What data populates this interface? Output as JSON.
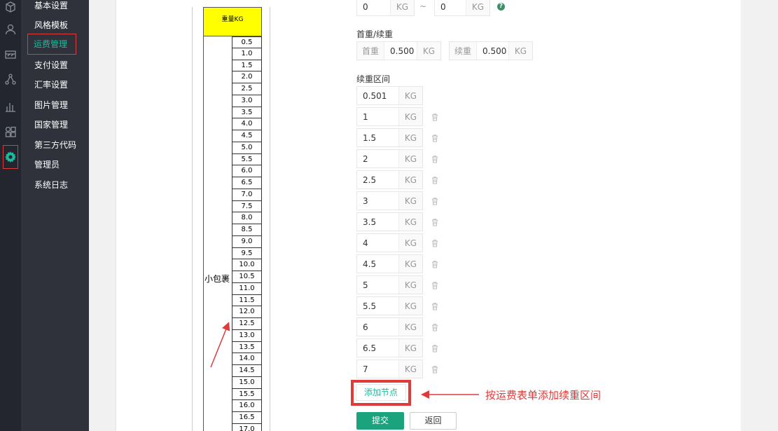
{
  "sidebar": {
    "icons": [
      "cube-icon",
      "user-icon",
      "card-icon",
      "network-icon",
      "bar-chart-icon",
      "grid-icon",
      "gear-icon"
    ],
    "items": [
      {
        "label": "基本设置"
      },
      {
        "label": "风格模板"
      },
      {
        "label": "运费管理",
        "active": true
      },
      {
        "label": "支付设置"
      },
      {
        "label": "汇率设置"
      },
      {
        "label": "图片管理"
      },
      {
        "label": "国家管理"
      },
      {
        "label": "第三方代码"
      },
      {
        "label": "管理员"
      },
      {
        "label": "系统日志"
      }
    ]
  },
  "sheet": {
    "header": "重量KG",
    "row_label": "小包裹",
    "weights": [
      "0.5",
      "1.0",
      "1.5",
      "2.0",
      "2.5",
      "3.0",
      "3.5",
      "4.0",
      "4.5",
      "5.0",
      "5.5",
      "6.0",
      "6.5",
      "7.0",
      "7.5",
      "8.0",
      "8.5",
      "9.0",
      "9.5",
      "10.0",
      "10.5",
      "11.0",
      "11.5",
      "12.0",
      "12.5",
      "13.0",
      "13.5",
      "14.0",
      "14.5",
      "15.0",
      "15.5",
      "16.0",
      "16.5",
      "17.0"
    ]
  },
  "form": {
    "range": {
      "min": "0",
      "max": "0",
      "unit": "KG",
      "separator": "~",
      "help": "?"
    },
    "first_weight_section": "首重/续重",
    "first_weight": {
      "prefix": "首重",
      "value": "0.500",
      "unit": "KG"
    },
    "continued_weight": {
      "prefix": "续重",
      "value": "0.500",
      "unit": "KG"
    },
    "intervals_section": "续重区间",
    "intervals": [
      "0.501",
      "1",
      "1.5",
      "2",
      "2.5",
      "3",
      "3.5",
      "4",
      "4.5",
      "5",
      "5.5",
      "6",
      "6.5",
      "7"
    ],
    "interval_unit": "KG",
    "add_node": "添加节点",
    "submit": "提交",
    "back": "返回"
  },
  "annotation": "按运费表单添加续重区间",
  "colors": {
    "accent": "#1abc9c",
    "highlight": "#e03b3b",
    "submit": "#1aa37c"
  }
}
